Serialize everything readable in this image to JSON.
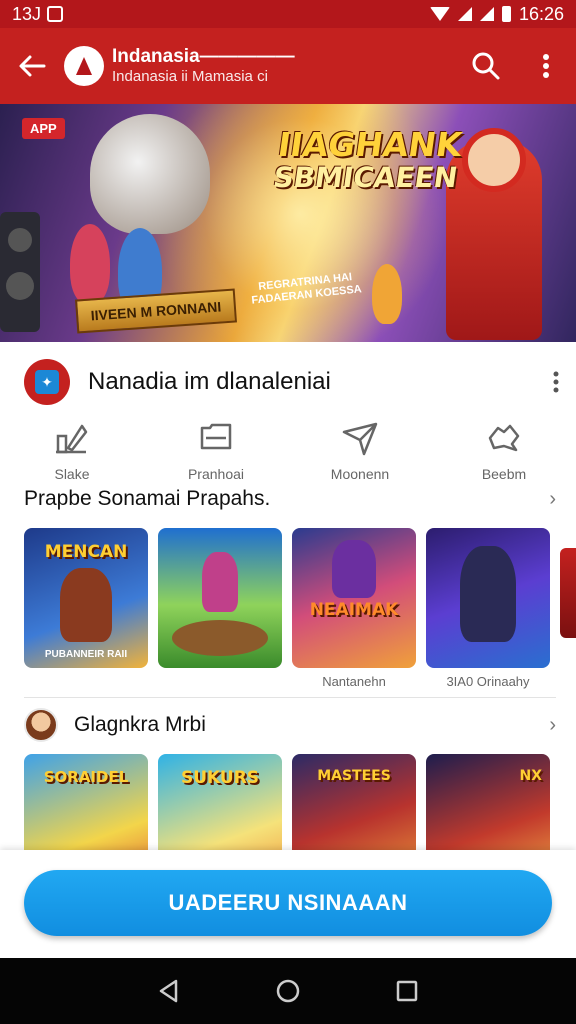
{
  "status_bar": {
    "time_left": "13J",
    "time_right": "16:26"
  },
  "app_bar": {
    "title": "Indanasia—————",
    "subtitle": "Indanasia ii Mamasia ci"
  },
  "banner": {
    "badge": "APP",
    "title_line1": "IIAGHANK",
    "title_line2": "SBMICAEEN",
    "tagline": "REGRATRINA HAI FADAERAN KOESSA",
    "ribbon": "IIVEEN M RONNANI"
  },
  "app_info": {
    "name": "Nanadia im dlanaleniai"
  },
  "actions": [
    {
      "label": "Slake",
      "icon": "share-icon"
    },
    {
      "label": "Pranhoai",
      "icon": "message-icon"
    },
    {
      "label": "Moonenn",
      "icon": "send-icon"
    },
    {
      "label": "Beebm",
      "icon": "wishlist-icon"
    }
  ],
  "section1": {
    "title": "Prapbe Sonamai Prapahs.",
    "cards": [
      {
        "art_title": "MENCAN",
        "art_foot": "PUBANNEIR RAII",
        "caption": ""
      },
      {
        "art_title": "",
        "art_foot": "",
        "caption": ""
      },
      {
        "art_title": "NEAIMAK",
        "art_foot": "",
        "caption": "Nantanehn"
      },
      {
        "art_title": "",
        "art_foot": "",
        "caption": "3IA0 Orinaahy"
      }
    ]
  },
  "section2": {
    "title": "Glagnkra Mrbi",
    "cards": [
      {
        "art_title": "SORAIDEL"
      },
      {
        "art_title": "SUKURS"
      },
      {
        "art_title": "MASTEES"
      },
      {
        "art_title": "NX"
      }
    ]
  },
  "install_button": "UADEERU NSINAAAN",
  "colors": {
    "app_bar": "#c4211f",
    "install": "#1a9ce9",
    "nav_bar": "#050505"
  }
}
